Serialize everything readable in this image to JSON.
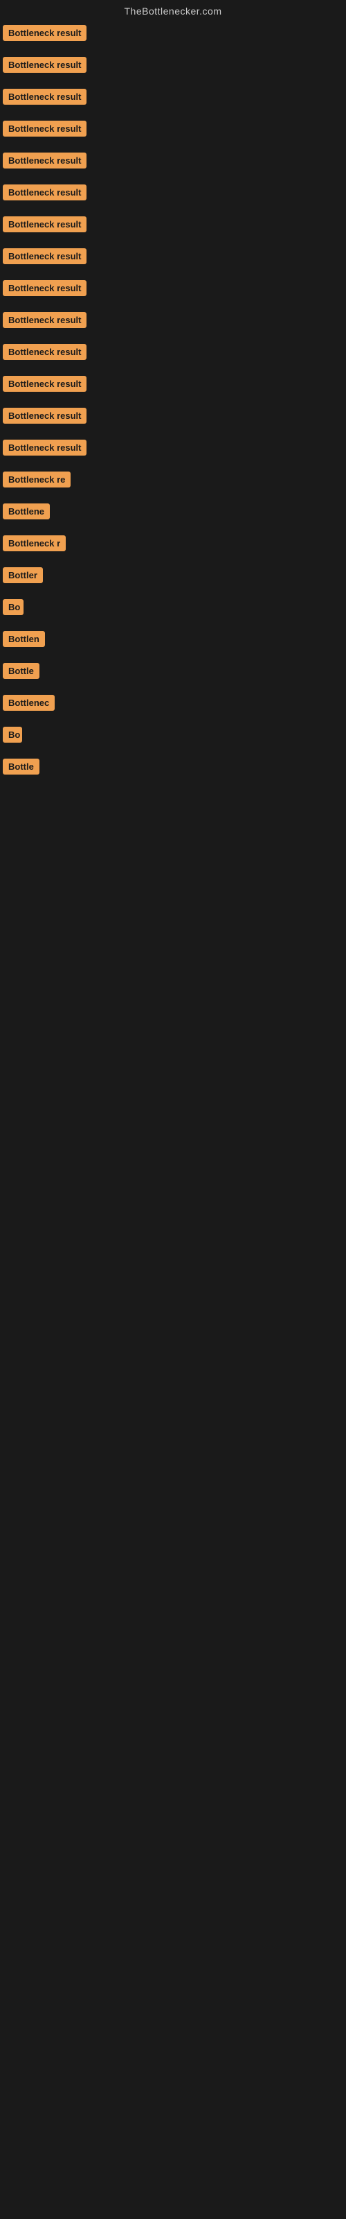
{
  "site": {
    "title": "TheBottlenecker.com"
  },
  "items": [
    {
      "label": "Bottleneck result",
      "width": 130
    },
    {
      "label": "Bottleneck result",
      "width": 130
    },
    {
      "label": "Bottleneck result",
      "width": 130
    },
    {
      "label": "Bottleneck result",
      "width": 130
    },
    {
      "label": "Bottleneck result",
      "width": 130
    },
    {
      "label": "Bottleneck result",
      "width": 130
    },
    {
      "label": "Bottleneck result",
      "width": 130
    },
    {
      "label": "Bottleneck result",
      "width": 130
    },
    {
      "label": "Bottleneck result",
      "width": 130
    },
    {
      "label": "Bottleneck result",
      "width": 130
    },
    {
      "label": "Bottleneck result",
      "width": 130
    },
    {
      "label": "Bottleneck result",
      "width": 130
    },
    {
      "label": "Bottleneck result",
      "width": 130
    },
    {
      "label": "Bottleneck result",
      "width": 130
    },
    {
      "label": "Bottleneck re",
      "width": 110
    },
    {
      "label": "Bottlene",
      "width": 85
    },
    {
      "label": "Bottleneck r",
      "width": 98
    },
    {
      "label": "Bottler",
      "width": 72
    },
    {
      "label": "Bo",
      "width": 30
    },
    {
      "label": "Bottlen",
      "width": 76
    },
    {
      "label": "Bottle",
      "width": 65
    },
    {
      "label": "Bottlenec",
      "width": 90
    },
    {
      "label": "Bo",
      "width": 28
    },
    {
      "label": "Bottle",
      "width": 62
    }
  ],
  "colors": {
    "badge_bg": "#f0a050",
    "badge_text": "#1a1a1a",
    "site_title": "#cccccc",
    "background": "#1a1a1a"
  }
}
